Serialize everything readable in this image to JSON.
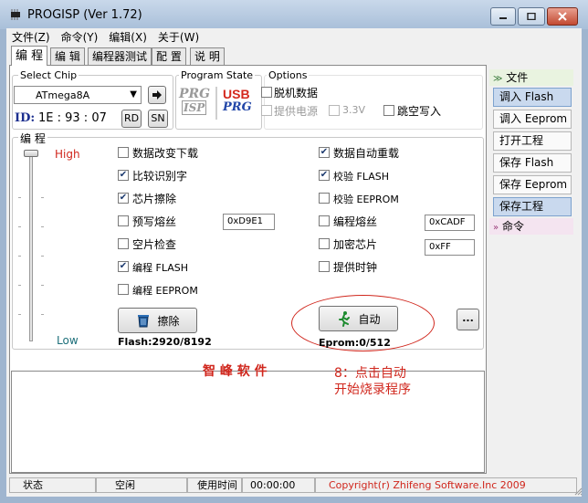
{
  "window": {
    "title": "PROGISP (Ver 1.72)"
  },
  "menu": [
    "文件(Z)",
    "命令(Y)",
    "编辑(X)",
    "关于(W)"
  ],
  "tabs": [
    "编 程",
    "编 辑",
    "编程器测试",
    "配 置",
    "说 明"
  ],
  "select_chip": {
    "legend": "Select Chip",
    "value": "ATmega8A",
    "id_label": "ID:",
    "id_value": "1E : 93 : 07",
    "rd_label": "RD",
    "sn_label": "SN"
  },
  "program_state": {
    "legend": "Program State",
    "prg_top": "PRG",
    "prg_bottom": "ISP",
    "usb_label": "USB",
    "usb_sub": "PRG"
  },
  "options": {
    "legend": "Options",
    "offline": "脱机数据",
    "power": "提供电源",
    "v33": "3.3V",
    "skip_empty": "跳空写入"
  },
  "program": {
    "legend": "编 程",
    "high": "High",
    "low": "Low",
    "left_checks": [
      {
        "label": "数据改变下载",
        "checked": false
      },
      {
        "label": "比较识别字",
        "checked": true
      },
      {
        "label": "芯片擦除",
        "checked": true
      },
      {
        "label": "预写熔丝",
        "checked": false
      },
      {
        "label": "空片检查",
        "checked": false
      },
      {
        "label": "编程 FLASH",
        "checked": true
      },
      {
        "label": "编程 EEPROM",
        "checked": false
      }
    ],
    "right_checks": [
      {
        "label": "数据自动重载",
        "checked": true
      },
      {
        "label": "校验 FLASH",
        "checked": true
      },
      {
        "label": "校验 EEPROM",
        "checked": false
      },
      {
        "label": "编程熔丝",
        "checked": false
      },
      {
        "label": "加密芯片",
        "checked": false
      },
      {
        "label": "提供时钟",
        "checked": false
      }
    ],
    "fuse_prewrite_value": "0xD9E1",
    "fuse_program_value": "0xCADF",
    "lock_value": "0xFF",
    "erase_label": "擦除",
    "auto_label": "自动",
    "more_label": "...",
    "flash_stat": "Flash:2920/8192",
    "eeprom_stat": "Eprom:0/512"
  },
  "annotation": {
    "watermark": "智 峰 软 件",
    "step": "8：点击自动",
    "step_line2": "开始烧录程序"
  },
  "sidebar": {
    "file_header": "文件",
    "items": [
      "调入 Flash",
      "调入 Eeprom",
      "打开工程",
      "保存 Flash",
      "保存 Eeprom",
      "保存工程"
    ],
    "command_header": "命令"
  },
  "status": {
    "state_label": "状态",
    "state_value": "空闲",
    "time_label": "使用时间",
    "time_value": "00:00:00",
    "copyright": "Copyright(r) Zhifeng Software.Inc 2009"
  }
}
